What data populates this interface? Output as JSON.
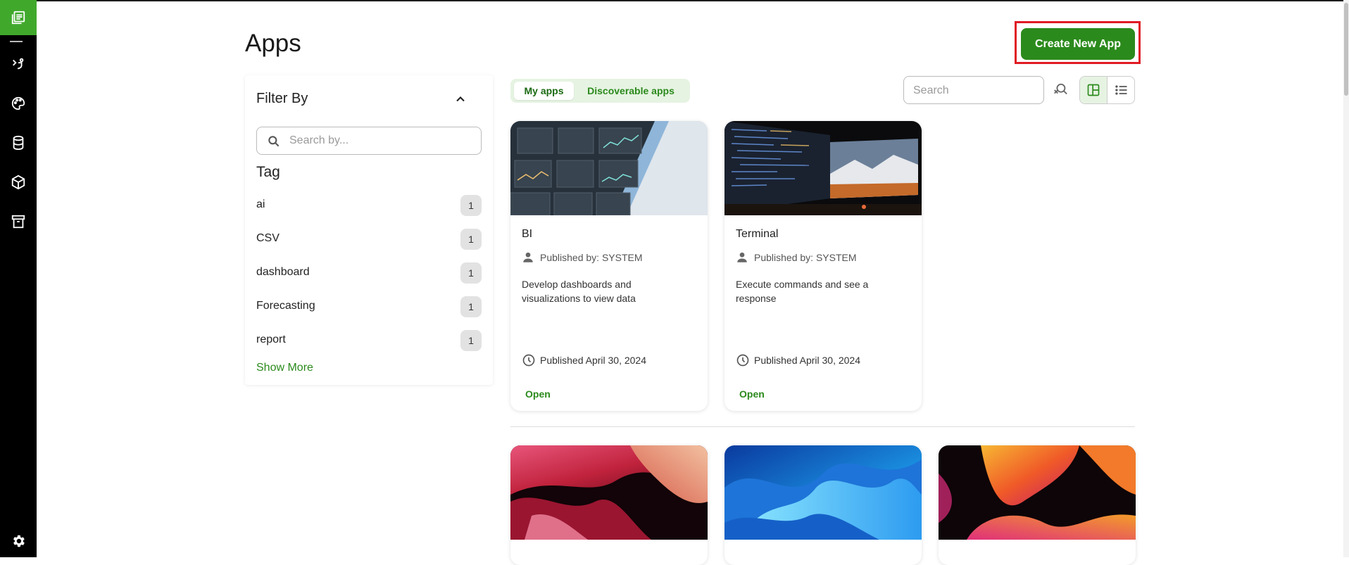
{
  "page": {
    "title": "Apps"
  },
  "header": {
    "create_label": "Create New App"
  },
  "rail": {
    "items": [
      {
        "icon": "library-icon"
      },
      {
        "icon": "flow-icon"
      },
      {
        "icon": "palette-icon"
      },
      {
        "icon": "database-icon"
      },
      {
        "icon": "cube-icon"
      },
      {
        "icon": "archive-icon"
      },
      {
        "icon": "gear-icon"
      }
    ]
  },
  "filter": {
    "title": "Filter By",
    "search_placeholder": "Search by...",
    "tag_title": "Tag",
    "tags": [
      {
        "name": "ai",
        "count": "1"
      },
      {
        "name": "CSV",
        "count": "1"
      },
      {
        "name": "dashboard",
        "count": "1"
      },
      {
        "name": "Forecasting",
        "count": "1"
      },
      {
        "name": "report",
        "count": "1"
      }
    ],
    "show_more": "Show More"
  },
  "tabs": [
    {
      "label": "My apps",
      "active": true
    },
    {
      "label": "Discoverable apps",
      "active": false
    }
  ],
  "search": {
    "placeholder": "Search"
  },
  "cards": [
    {
      "title": "BI",
      "publisher": "Published by: SYSTEM",
      "description": "Develop dashboards and visualizations to view data",
      "date": "Published April 30, 2024",
      "action": "Open"
    },
    {
      "title": "Terminal",
      "publisher": "Published by: SYSTEM",
      "description": "Execute commands and see a response",
      "date": "Published April 30, 2024",
      "action": "Open"
    }
  ],
  "colors": {
    "accent": "#2b8a1c",
    "rail_logo": "#40a92c",
    "highlight": "#e01b24"
  }
}
